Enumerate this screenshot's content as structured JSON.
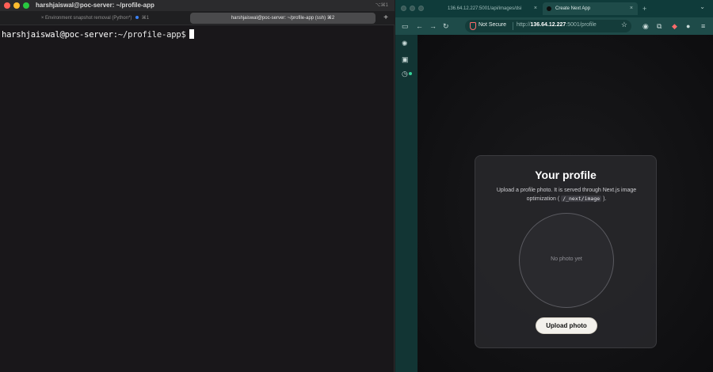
{
  "terminal": {
    "title": "harshjaiswal@poc-server: ~/profile-app",
    "shortcut": "⌥⌘1",
    "tabs": [
      {
        "label": "Environment snapshot removal (Python*)",
        "shortcut": "⌘1"
      },
      {
        "label": "harshjaiswal@poc-server: ~/profile-app (ssh)",
        "shortcut": "⌘2"
      }
    ],
    "new_tab_label": "+",
    "prompt_user": "harshjaiswal@poc-server",
    "prompt_path": ":~/profile-app$"
  },
  "browser": {
    "tabs": [
      {
        "label": "136.64.12.227:5001/api/images/dsi",
        "close": "×"
      },
      {
        "label": "Create Next App",
        "close": "×"
      }
    ],
    "new_tab_label": "+",
    "url": {
      "security": "Not Secure",
      "scheme": "http://",
      "host": "136.64.12.227",
      "rest": ":5001/profile"
    }
  },
  "page": {
    "title": "Your profile",
    "desc_prefix": "Upload a profile photo. It is served through Next.js image optimization (",
    "desc_code": "/_next/image",
    "desc_suffix": ").",
    "avatar_placeholder": "No photo yet",
    "upload_label": "Upload photo"
  }
}
